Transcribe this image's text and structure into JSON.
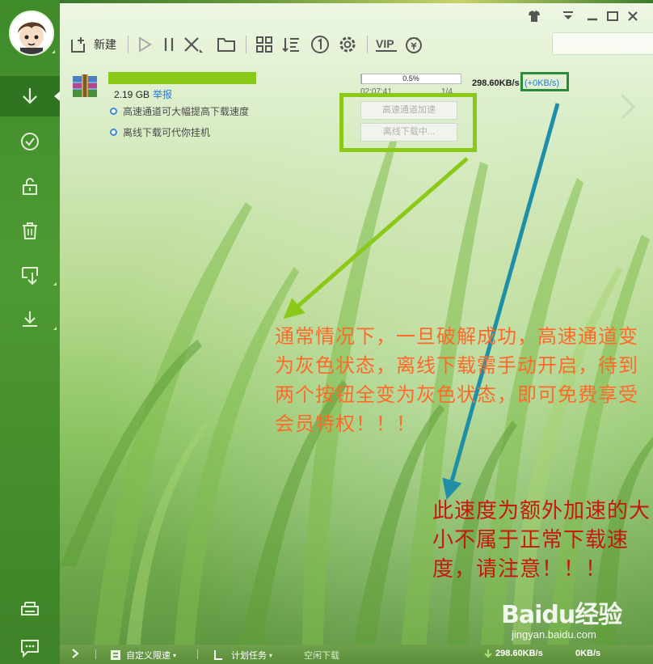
{
  "toolbar": {
    "new_label": "新建",
    "icons": [
      "plus-icon",
      "play-icon",
      "pause-icon",
      "close-icon",
      "folder-icon",
      "grid-icon",
      "sort-icon",
      "one-icon",
      "gear-icon",
      "vip-icon",
      "piggy-icon"
    ],
    "vip_text": "VIP",
    "search_placeholder": ""
  },
  "sidebar": {
    "items": [
      "download-icon",
      "check-icon",
      "unlock-icon",
      "trash-icon",
      "import-icon",
      "export-icon",
      "printer-icon",
      "chat-icon"
    ],
    "active": "download-icon"
  },
  "task": {
    "size": "2.19 GB",
    "report_label": "举报",
    "hint1": "高速通道可大幅提高下载速度",
    "hint2": "离线下载可代你挂机",
    "progress": "0.5%",
    "progress_fraction": 0.005,
    "eta": "02:07:41",
    "parts": "1/4",
    "speed": "298.60KB/s",
    "extra_speed": "(+0KB/s)",
    "button1": "高速通道加速",
    "button2": "离线下载中..."
  },
  "annotations": {
    "note1": "通常情况下，一旦破解成功，高速通道变为灰色状态，离线下载需手动开启，待到两个按钮全变为灰色状态，即可免费享受会员特权！！！",
    "note2": "此速度为额外加速的大小不属于正常下载速度，请注意！！！",
    "arrow1_color": "#8bc919",
    "arrow2_color": "#1f8fa8"
  },
  "watermark": {
    "brand": "Baidu经验",
    "url": "jingyan.baidu.com"
  },
  "bottombar": {
    "speed_limit_label": "自定义限速",
    "scheduled_label": "计划任务",
    "idle_label": "空闲下载",
    "down_speed": "298.60KB/s",
    "up_speed": "0KB/s"
  }
}
